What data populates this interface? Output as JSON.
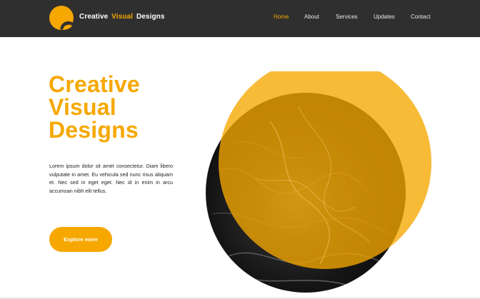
{
  "brand": {
    "name_part1": "Creative",
    "name_accent": "Visual",
    "name_part2": "Designs",
    "accent_color": "#f6a800"
  },
  "nav": {
    "items": [
      {
        "label": "Home",
        "active": true
      },
      {
        "label": "About",
        "active": false
      },
      {
        "label": "Services",
        "active": false
      },
      {
        "label": "Updates",
        "active": false
      },
      {
        "label": "Contact",
        "active": false
      }
    ]
  },
  "hero": {
    "title_line1": "Creative",
    "title_line2": "Visual",
    "title_line3": "Designs",
    "body": "Lorem ipsum dolor sit amet consectetur. Diam libero vulputate in amet. Eu vehicula sed nunc risus aliquam et. Nec sed in eget eget. Nec id in enim in arcu accumsan nibh elit tellus.",
    "cta_label": "Explore more"
  },
  "colors": {
    "nav_background": "#2f2f2f",
    "accent": "#f6a800",
    "page_background": "#ffffff"
  },
  "icons": {
    "logo": "logo-mark-icon"
  }
}
